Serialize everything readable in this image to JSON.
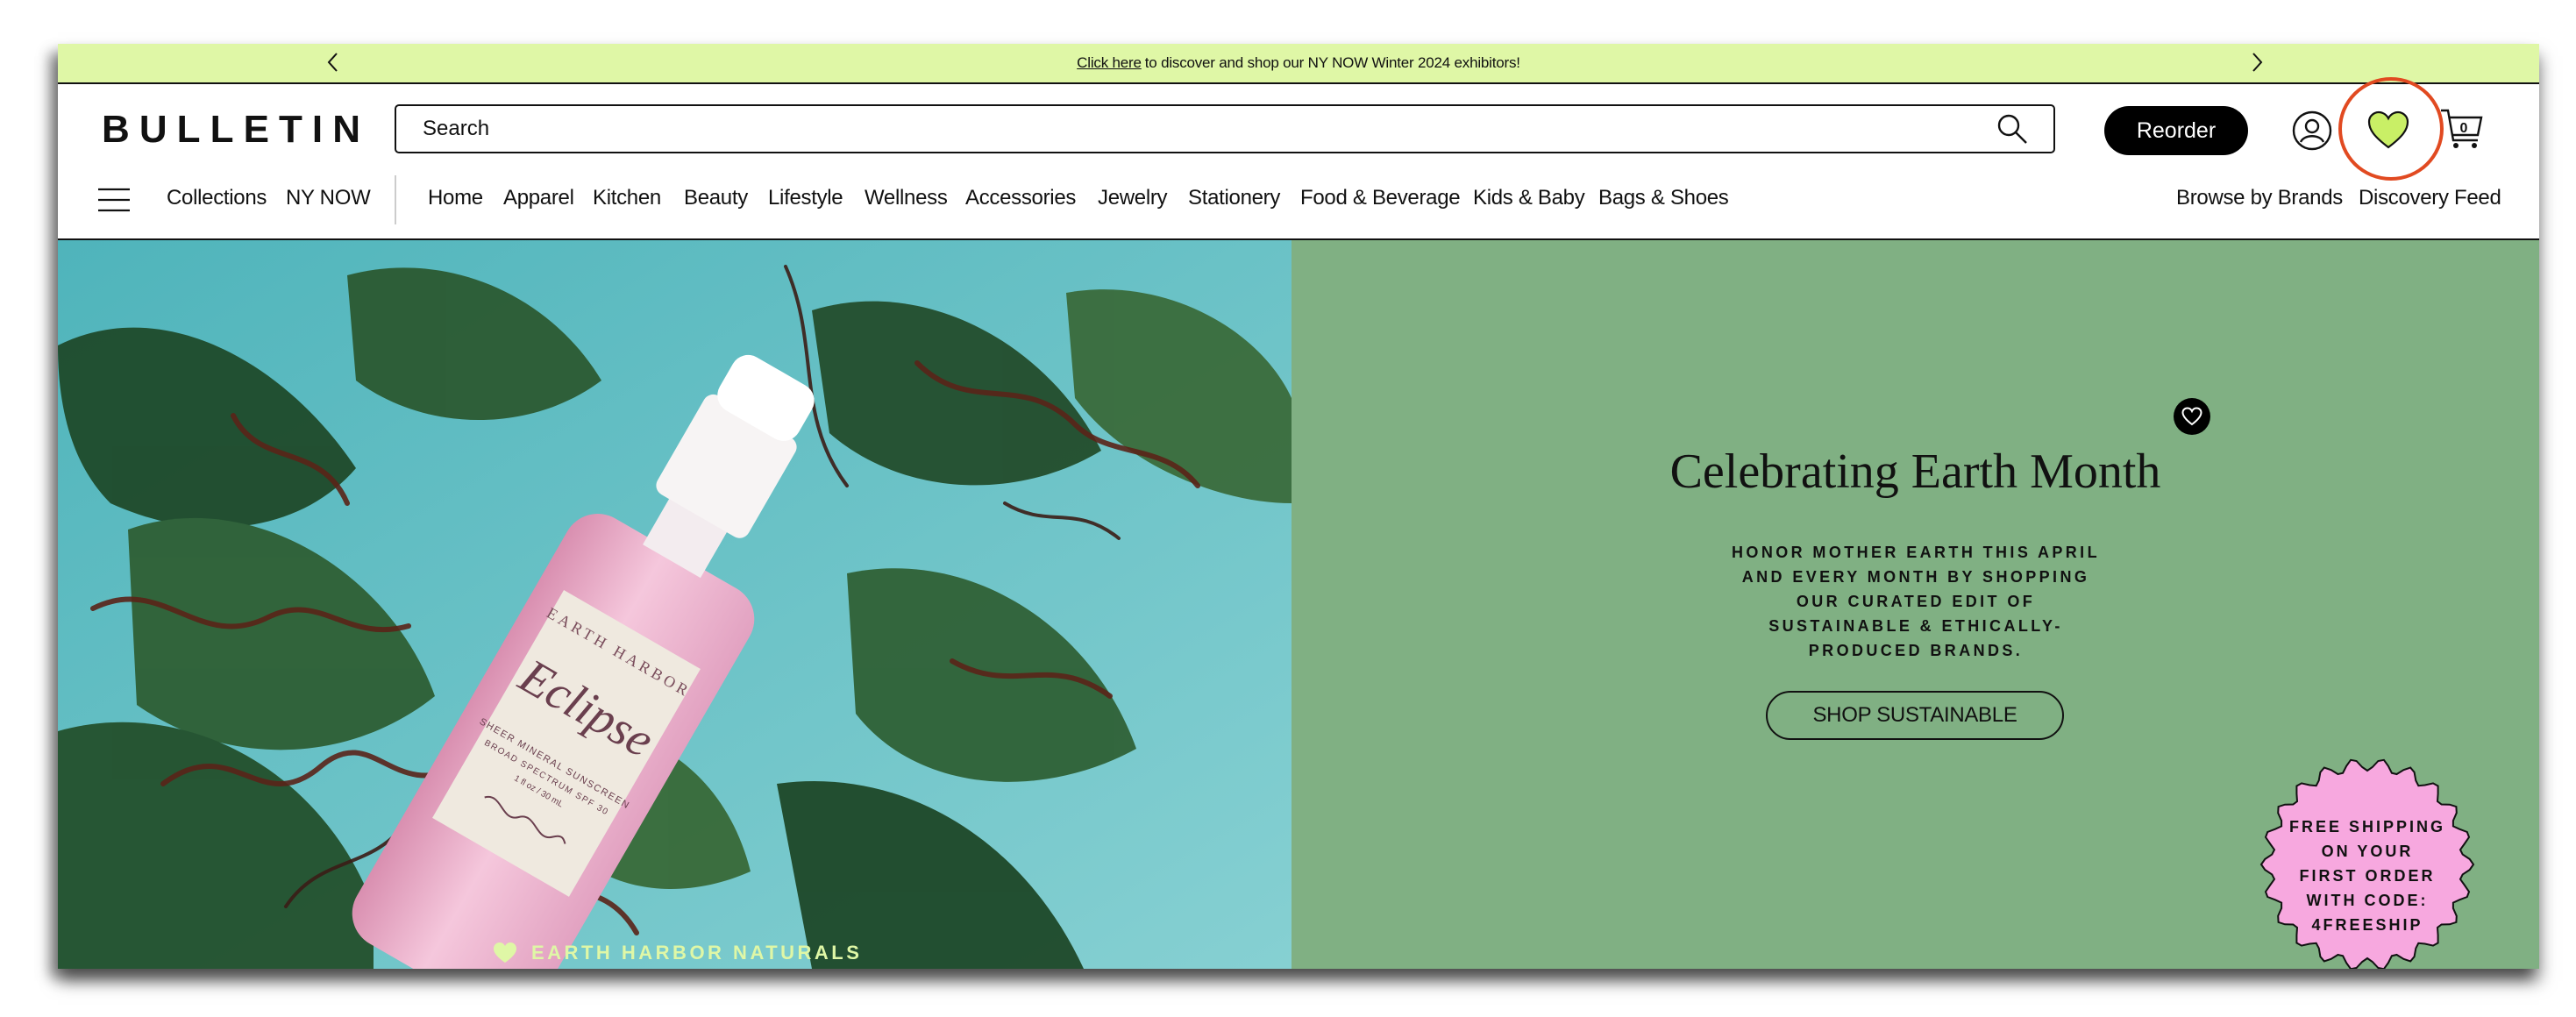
{
  "promo": {
    "link_text": "Click here",
    "message": "to discover and shop our NY NOW Winter 2024 exhibitors!",
    "background": "#dff7a6"
  },
  "header": {
    "logo": "BULLETIN",
    "search_placeholder": "Search",
    "reorder_label": "Reorder",
    "cart_count": "0",
    "highlight_color": "#e14a21"
  },
  "nav": {
    "left": [
      "Collections",
      "NY NOW"
    ],
    "categories": [
      "Home",
      "Apparel",
      "Kitchen",
      "Beauty",
      "Lifestyle",
      "Wellness",
      "Accessories",
      "Jewelry",
      "Stationery",
      "Food & Beverage",
      "Kids & Baby",
      "Bags & Shoes"
    ],
    "right": [
      "Browse by Brands",
      "Discovery Feed"
    ]
  },
  "hero": {
    "title": "Celebrating Earth Month",
    "subtitle": "HONOR MOTHER EARTH THIS APRIL AND EVERY MONTH BY SHOPPING OUR CURATED EDIT OF SUSTAINABLE & ETHICALLY-PRODUCED BRANDS.",
    "button": "SHOP SUSTAINABLE",
    "brand_tag": "EARTH HARBOR NATURALS",
    "bottle_brand": "EARTH HARBOR",
    "bottle_name": "Eclipse",
    "bottle_desc": "SHEER MINERAL SUNSCREEN",
    "bottle_desc2": "BROAD SPECTRUM SPF 30",
    "bottle_size": "1 fl oz / 30 mL",
    "badge_lines": [
      "FREE SHIPPING",
      "ON YOUR",
      "FIRST ORDER",
      "WITH CODE:",
      "4FREESHIP"
    ],
    "panel_color": "#80b083",
    "badge_color": "#f7a8df"
  }
}
